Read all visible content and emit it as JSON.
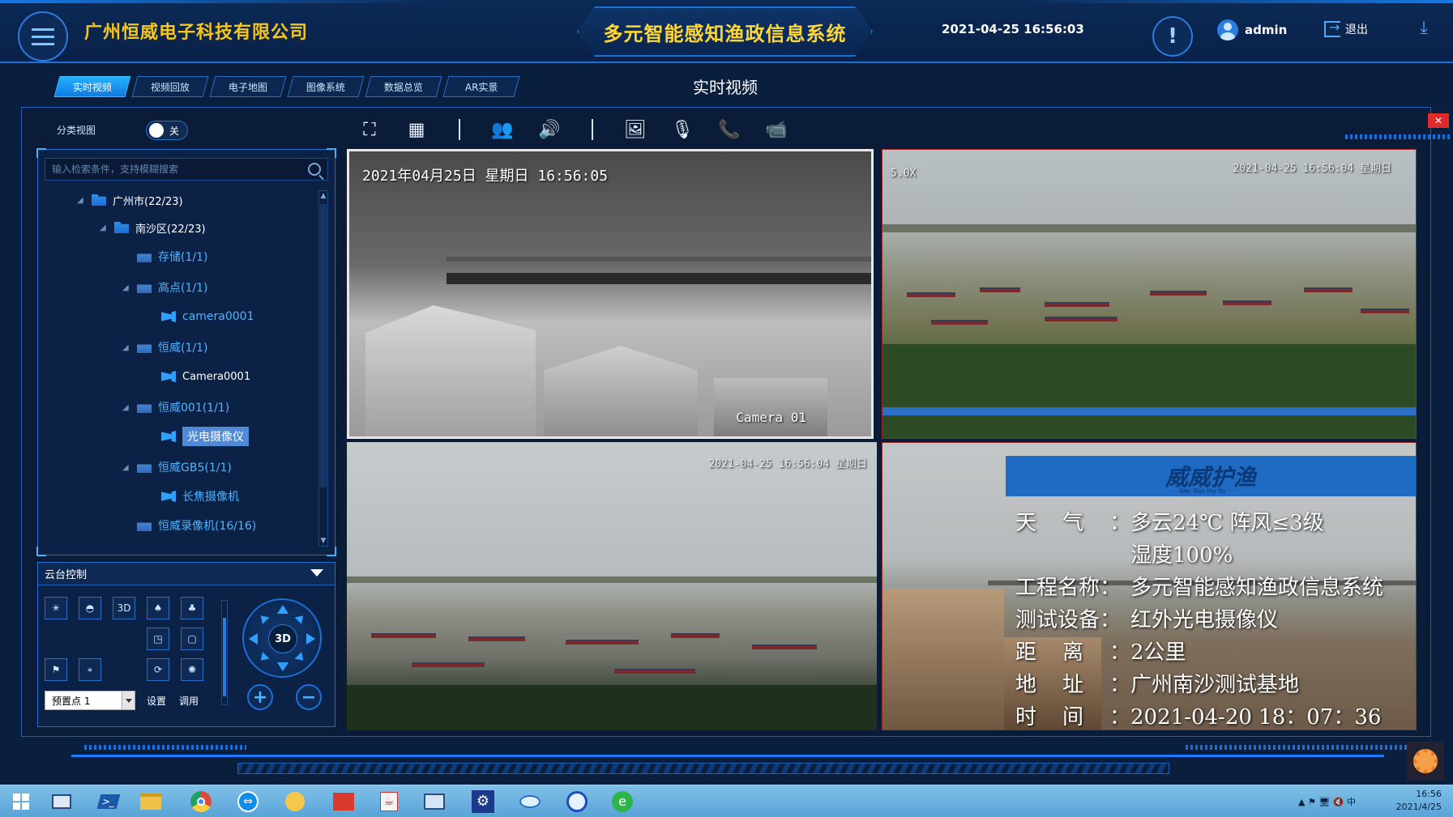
{
  "header": {
    "company": "广州恒威电子科技有限公司",
    "system_title": "多元智能感知渔政信息系统",
    "datetime": "2021-04-25 16:56:03",
    "user": "admin",
    "logout": "退出"
  },
  "tabs": [
    {
      "label": "实时视频",
      "active": true
    },
    {
      "label": "视频回放",
      "active": false
    },
    {
      "label": "电子地图",
      "active": false
    },
    {
      "label": "图像系统",
      "active": false
    },
    {
      "label": "数据总览",
      "active": false
    },
    {
      "label": "AR实景",
      "active": false
    }
  ],
  "page_heading": "实时视频",
  "toolbar": {
    "classify_label": "分类视图",
    "toggle_text": "关",
    "toggle_on": false
  },
  "search": {
    "placeholder": "输入检索条件，支持模糊搜索"
  },
  "tree": {
    "guangzhou": "广州市(22/23)",
    "nansha": "南沙区(22/23)",
    "storage": "存储(1/1)",
    "gaodian": "高点(1/1)",
    "gaodian_cam": "camera0001",
    "hengwei": "恒威(1/1)",
    "hengwei_cam": "Camera0001",
    "hengwei001": "恒威001(1/1)",
    "hengwei001_cam": "光电摄像仪",
    "hengweigb5": "恒威GB5(1/1)",
    "hengweigb5_cam": "长焦摄像机",
    "recorder": "恒威录像机(16/16)"
  },
  "ptz": {
    "title": "云台控制",
    "btn_3d": "3D",
    "center": "3D",
    "preset_value": "预置点 1",
    "set_label": "设置",
    "call_label": "调用",
    "zoom_level": 0.77
  },
  "videos": {
    "v1_date": "2021年04月25日  星期日  16:56:05",
    "v1_cam": "Camera 01",
    "v2_small_left": "5.0X",
    "v2_date": "2021-04-25 16:56:04 星期日",
    "v3_date": "2021-04-25 16:56:04 星期日",
    "v4": {
      "brand": "威威护渔",
      "brand_sub": "Wei Wei Hu Yu",
      "lines": [
        {
          "k": "天气：",
          "v": "多云24℃ 阵风≤3级"
        },
        {
          "k": "",
          "v": "湿度100%"
        },
        {
          "k": "工程名称：",
          "v": "多元智能感知渔政信息系统"
        },
        {
          "k": "测试设备：",
          "v": "红外光电摄像仪"
        },
        {
          "k": "距离：",
          "v": "2公里"
        },
        {
          "k": "地址：",
          "v": "广州南沙测试基地"
        },
        {
          "k": "时间：",
          "v": "2021-04-20 18：07：36"
        }
      ]
    }
  },
  "taskbar": {
    "time": "16:56",
    "date": "2021/4/25"
  },
  "colors": {
    "accent": "#1d6fd8",
    "company": "#f5c61c",
    "title": "#ffd634",
    "tab_active": "#27b0ff",
    "tree_folder_text": "#4fb4ff",
    "close": "#e02b2b"
  }
}
